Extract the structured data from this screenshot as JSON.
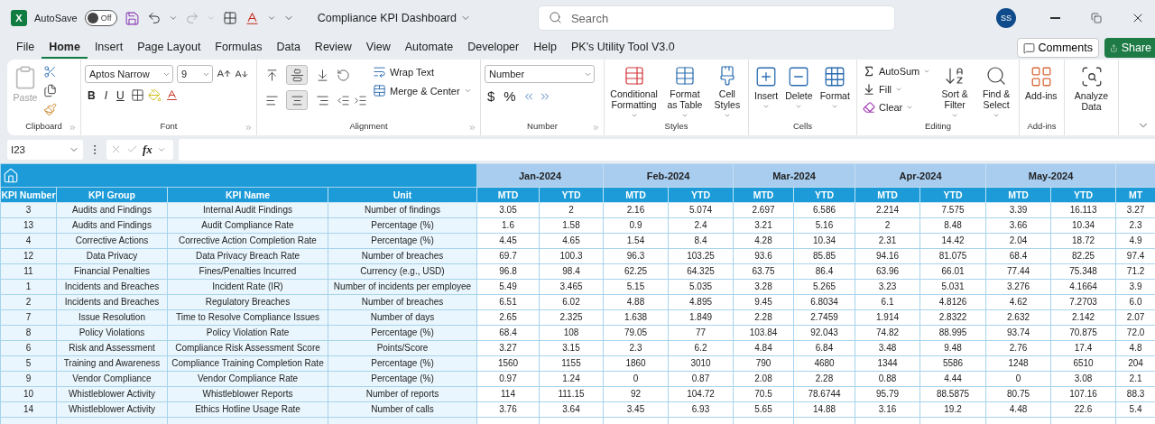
{
  "title_bar": {
    "app_logo": "X",
    "autosave_label": "AutoSave",
    "autosave": {
      "on": false,
      "label": "Off"
    },
    "document_title": "Compliance KPI Dashboard",
    "search": {
      "placeholder": "Search"
    },
    "avatar": "SS"
  },
  "menu_tabs": [
    {
      "label": "File",
      "selected": false
    },
    {
      "label": "Home",
      "selected": true
    },
    {
      "label": "Insert",
      "selected": false
    },
    {
      "label": "Page Layout",
      "selected": false
    },
    {
      "label": "Formulas",
      "selected": false
    },
    {
      "label": "Data",
      "selected": false
    },
    {
      "label": "Review",
      "selected": false
    },
    {
      "label": "View",
      "selected": false
    },
    {
      "label": "Automate",
      "selected": false
    },
    {
      "label": "Developer",
      "selected": false
    },
    {
      "label": "Help",
      "selected": false
    },
    {
      "label": "PK's Utility Tool V3.0",
      "selected": false
    }
  ],
  "comments_button": "Comments",
  "share_button": "Share",
  "ribbon": {
    "clipboard": {
      "label": "Clipboard",
      "paste": {
        "label": "Paste",
        "disabled": true
      }
    },
    "font": {
      "label": "Font",
      "family": "Aptos Narrow",
      "size": "9",
      "styles": [
        "B",
        "I",
        "U"
      ]
    },
    "alignment": {
      "label": "Alignment",
      "vertical_buttons": [
        {
          "selected": false
        },
        {
          "selected": true
        },
        {
          "selected": false
        }
      ],
      "horizontal_buttons": [
        {
          "selected": false
        },
        {
          "selected": true
        },
        {
          "selected": false
        }
      ],
      "wrap_text": "Wrap Text",
      "merge_center": "Merge & Center"
    },
    "number": {
      "label": "Number",
      "format": "Number",
      "symbols": [
        "$",
        "%"
      ]
    },
    "styles": {
      "label": "Styles",
      "buttons": [
        "Conditional Formatting",
        "Format as Table",
        "Cell Styles"
      ]
    },
    "cells": {
      "label": "Cells",
      "buttons": [
        "Insert",
        "Delete",
        "Format"
      ]
    },
    "editing": {
      "label": "Editing",
      "small_buttons": [
        "AutoSum",
        "Fill",
        "Clear"
      ],
      "buttons": [
        "Sort & Filter",
        "Find & Select"
      ]
    },
    "add_ins": {
      "label": "Add-ins",
      "buttons": [
        "Add-ins"
      ]
    },
    "analyze": {
      "buttons": [
        "Analyze Data"
      ]
    }
  },
  "formula_bar": {
    "name_box": "I23",
    "function_label": "fx"
  },
  "sheet": {
    "headers": [
      "KPI Number",
      "KPI Group",
      "KPI Name",
      "Unit"
    ],
    "months": [
      "Jan-2024",
      "Feb-2024",
      "Mar-2024",
      "Apr-2024",
      "May-2024"
    ],
    "value_columns": [
      "MTD",
      "YTD",
      "MTD",
      "YTD",
      "MTD",
      "YTD",
      "MTD",
      "YTD",
      "MTD",
      "YTD",
      "MT"
    ],
    "rows": [
      {
        "kpi_number": "3",
        "group": "Audits and Findings",
        "name": "Internal Audit Findings",
        "unit": "Number of findings",
        "values": [
          "3.05",
          "2",
          "2.16",
          "5.074",
          "2.697",
          "6.586",
          "2.214",
          "7.575",
          "3.39",
          "16.113",
          "3.27"
        ]
      },
      {
        "kpi_number": "13",
        "group": "Audits and Findings",
        "name": "Audit Compliance Rate",
        "unit": "Percentage (%)",
        "values": [
          "1.6",
          "1.58",
          "0.9",
          "2.4",
          "3.21",
          "5.16",
          "2",
          "8.48",
          "3.66",
          "10.34",
          "2.3"
        ]
      },
      {
        "kpi_number": "4",
        "group": "Corrective Actions",
        "name": "Corrective Action Completion Rate",
        "unit": "Percentage (%)",
        "values": [
          "4.45",
          "4.65",
          "1.54",
          "8.4",
          "4.28",
          "10.34",
          "2.31",
          "14.42",
          "2.04",
          "18.72",
          "4.9"
        ]
      },
      {
        "kpi_number": "12",
        "group": "Data Privacy",
        "name": "Data Privacy Breach Rate",
        "unit": "Number of breaches",
        "values": [
          "69.7",
          "100.3",
          "96.3",
          "103.25",
          "93.6",
          "85.85",
          "94.16",
          "81.075",
          "68.4",
          "82.25",
          "97.4"
        ]
      },
      {
        "kpi_number": "11",
        "group": "Financial Penalties",
        "name": "Fines/Penalties Incurred",
        "unit": "Currency (e.g., USD)",
        "values": [
          "96.8",
          "98.4",
          "62.25",
          "64.325",
          "63.75",
          "86.4",
          "63.96",
          "66.01",
          "77.44",
          "75.348",
          "71.2"
        ]
      },
      {
        "kpi_number": "1",
        "group": "Incidents and Breaches",
        "name": "Incident Rate (IR)",
        "unit": "Number of incidents per employee",
        "values": [
          "5.49",
          "3.465",
          "5.15",
          "5.035",
          "3.28",
          "5.265",
          "3.23",
          "5.031",
          "3.276",
          "4.1664",
          "3.9"
        ]
      },
      {
        "kpi_number": "2",
        "group": "Incidents and Breaches",
        "name": "Regulatory Breaches",
        "unit": "Number of breaches",
        "values": [
          "6.51",
          "6.02",
          "4.88",
          "4.895",
          "9.45",
          "6.8034",
          "6.1",
          "4.8126",
          "4.62",
          "7.2703",
          "6.0"
        ]
      },
      {
        "kpi_number": "7",
        "group": "Issue Resolution",
        "name": "Time to Resolve Compliance Issues",
        "unit": "Number of days",
        "values": [
          "2.65",
          "2.325",
          "1.638",
          "1.849",
          "2.28",
          "2.7459",
          "1.914",
          "2.8322",
          "2.632",
          "2.142",
          "2.07"
        ]
      },
      {
        "kpi_number": "8",
        "group": "Policy Violations",
        "name": "Policy Violation Rate",
        "unit": "Percentage (%)",
        "values": [
          "68.4",
          "108",
          "79.05",
          "77",
          "103.84",
          "92.043",
          "74.82",
          "88.995",
          "93.74",
          "70.875",
          "72.0"
        ]
      },
      {
        "kpi_number": "6",
        "group": "Risk and Assessment",
        "name": "Compliance Risk Assessment Score",
        "unit": "Points/Score",
        "values": [
          "3.27",
          "3.15",
          "2.3",
          "6.2",
          "4.84",
          "6.84",
          "3.48",
          "9.48",
          "2.76",
          "17.4",
          "4.8"
        ]
      },
      {
        "kpi_number": "5",
        "group": "Training and Awareness",
        "name": "Compliance Training Completion Rate",
        "unit": "Percentage (%)",
        "values": [
          "1560",
          "1155",
          "1860",
          "3010",
          "790",
          "4680",
          "1344",
          "5586",
          "1248",
          "6510",
          "204"
        ]
      },
      {
        "kpi_number": "9",
        "group": "Vendor Compliance",
        "name": "Vendor Compliance Rate",
        "unit": "Percentage (%)",
        "values": [
          "0.97",
          "1.24",
          "0",
          "0.87",
          "2.08",
          "2.28",
          "0.88",
          "4.44",
          "0",
          "3.08",
          "2.1"
        ]
      },
      {
        "kpi_number": "10",
        "group": "Whistleblower Activity",
        "name": "Whistleblower Reports",
        "unit": "Number of reports",
        "values": [
          "114",
          "111.15",
          "92",
          "104.72",
          "70.5",
          "78.6744",
          "95.79",
          "88.5875",
          "80.75",
          "107.16",
          "88.3"
        ]
      },
      {
        "kpi_number": "14",
        "group": "Whistleblower Activity",
        "name": "Ethics Hotline Usage Rate",
        "unit": "Number of calls",
        "values": [
          "3.76",
          "3.64",
          "3.45",
          "6.93",
          "5.65",
          "14.88",
          "3.16",
          "19.2",
          "4.48",
          "22.6",
          "5.4"
        ]
      }
    ]
  }
}
